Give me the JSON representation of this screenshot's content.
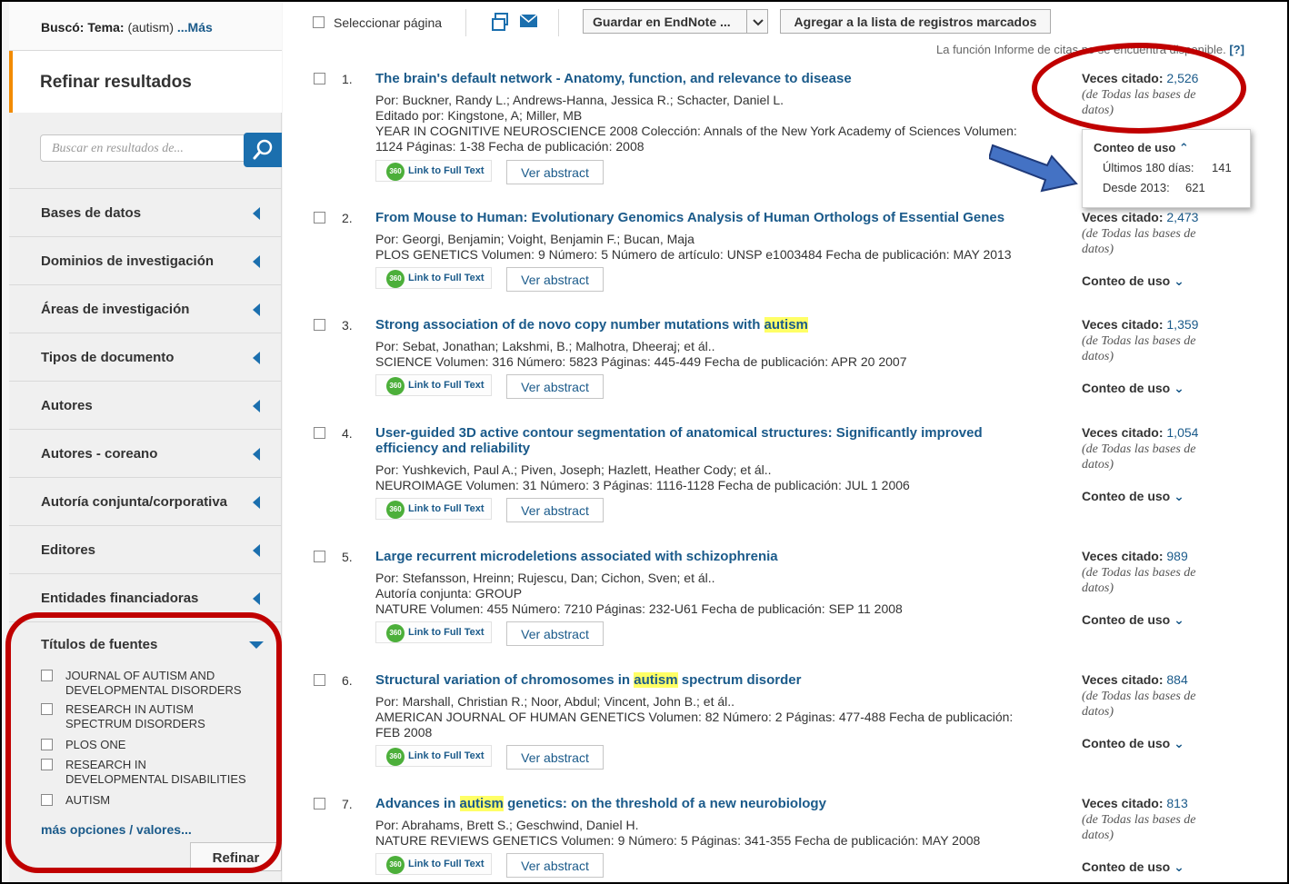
{
  "search_summary": {
    "label": "Buscó:",
    "field": "Tema:",
    "term": "(autism)",
    "more": "...Más"
  },
  "refine": {
    "title": "Refinar resultados",
    "search_placeholder": "Buscar en resultados de...",
    "facets": [
      "Bases de datos",
      "Dominios de investigación",
      "Áreas de investigación",
      "Tipos de documento",
      "Autores",
      "Autores - coreano",
      "Autoría conjunta/corporativa",
      "Editores",
      "Entidades financiadoras"
    ],
    "source_titles": {
      "title": "Títulos de fuentes",
      "items": [
        "JOURNAL OF AUTISM AND DEVELOPMENTAL DISORDERS",
        "RESEARCH IN AUTISM SPECTRUM DISORDERS",
        "PLOS ONE",
        "RESEARCH IN DEVELOPMENTAL DISABILITIES",
        "AUTISM"
      ],
      "more": "más opciones / valores...",
      "refine_button": "Refinar"
    }
  },
  "toolbar": {
    "select_page": "Seleccionar página",
    "endnote": "Guardar en EndNote ...",
    "add_marked": "Agregar a la lista de registros marcados",
    "citation_note_a": "La función Informe de citas ",
    "citation_note_b": "no se encuentra disponible.",
    "help": "[?]"
  },
  "records": [
    {
      "num": "1.",
      "title": "The brain's default network - Anatomy, function, and relevance to disease",
      "meta": [
        "Por: Buckner, Randy L.; Andrews-Hanna, Jessica R.; Schacter, Daniel L.",
        "Editado por: Kingstone, A; Miller, MB",
        "YEAR IN COGNITIVE NEUROSCIENCE 2008  Colección: Annals of the New York Academy of Sciences   Volumen:",
        "1124   Páginas: 1-38   Fecha de publicación: 2008"
      ],
      "cites": "2,526"
    },
    {
      "num": "2.",
      "title": "From Mouse to Human: Evolutionary Genomics Analysis of Human Orthologs of Essential Genes",
      "meta": [
        "Por: Georgi, Benjamin; Voight, Benjamin F.; Bucan, Maja",
        "PLOS GENETICS   Volumen: 9   Número: 5     Número de artículo: UNSP e1003484   Fecha de publicación: MAY 2013"
      ],
      "cites": "2,473"
    },
    {
      "num": "3.",
      "title_pre": "Strong association of de novo copy number mutations with ",
      "title_hl": "autism",
      "title_post": "",
      "meta": [
        "Por: Sebat, Jonathan; Lakshmi, B.; Malhotra, Dheeraj; et ál..",
        "SCIENCE   Volumen: 316   Número: 5823   Páginas: 445-449   Fecha de publicación: APR 20 2007"
      ],
      "cites": "1,359"
    },
    {
      "num": "4.",
      "title": "User-guided 3D active contour segmentation of anatomical structures: Significantly improved efficiency and reliability",
      "meta": [
        "Por: Yushkevich, Paul A.; Piven, Joseph; Hazlett, Heather Cody; et ál..",
        "NEUROIMAGE   Volumen: 31   Número: 3   Páginas: 1116-1128   Fecha de publicación: JUL 1 2006"
      ],
      "cites": "1,054"
    },
    {
      "num": "5.",
      "title": "Large recurrent microdeletions associated with schizophrenia",
      "meta": [
        "Por: Stefansson, Hreinn; Rujescu, Dan; Cichon, Sven; et ál..",
        "Autoría conjunta: GROUP",
        "NATURE   Volumen: 455   Número: 7210   Páginas: 232-U61   Fecha de publicación: SEP 11 2008"
      ],
      "cites": "989"
    },
    {
      "num": "6.",
      "title_pre": "Structural variation of chromosomes in ",
      "title_hl": "autism",
      "title_post": " spectrum disorder",
      "meta": [
        "Por: Marshall, Christian R.; Noor, Abdul; Vincent, John B.; et ál..",
        "AMERICAN JOURNAL OF HUMAN GENETICS   Volumen: 82   Número: 2   Páginas: 477-488   Fecha de publicación:",
        "FEB 2008"
      ],
      "cites": "884"
    },
    {
      "num": "7.",
      "title_pre": "Advances in ",
      "title_hl": "autism",
      "title_post": " genetics: on the threshold of a new neurobiology",
      "meta": [
        "Por: Abrahams, Brett S.; Geschwind, Daniel H.",
        "NATURE REVIEWS GENETICS   Volumen: 9   Número: 5   Páginas: 341-355   Fecha de publicación: MAY 2008"
      ],
      "cites": "813"
    }
  ],
  "labels": {
    "link360": "Link to Full Text",
    "badge360": "360",
    "abstract": "Ver abstract",
    "cited_label": "Veces citado:",
    "cited_note": "(de Todas las bases de datos)",
    "usage": "Conteo de uso"
  },
  "usage_popup": {
    "title": "Conteo de uso",
    "row1_label": "Últimos 180 días:",
    "row1_value": "141",
    "row2_label": "Desde 2013:",
    "row2_value": "621"
  },
  "colors": {
    "accent": "#1b6fae",
    "link": "#1a5a8a",
    "highlight": "#ffff66",
    "annotation_red": "#c00000",
    "refine_orange": "#f28b00"
  }
}
